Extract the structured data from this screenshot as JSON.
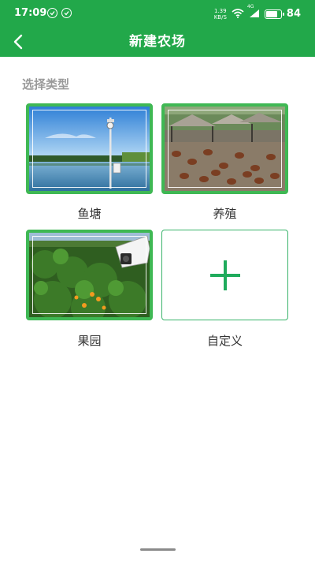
{
  "status_bar": {
    "time": "17:09",
    "net_speed_value": "1.39",
    "net_speed_unit": "KB/S",
    "signal_label": "4G",
    "battery_level": 84,
    "battery_text": "84"
  },
  "nav": {
    "title": "新建农场"
  },
  "section": {
    "label": "选择类型"
  },
  "types": [
    {
      "label": "鱼塘",
      "image": "fish-pond-photo"
    },
    {
      "label": "养殖",
      "image": "poultry-farm-photo"
    },
    {
      "label": "果园",
      "image": "orchard-photo"
    },
    {
      "label": "自定义",
      "image": "plus-icon"
    }
  ],
  "colors": {
    "header": "#22a84a",
    "card_border": "#3fb854",
    "plus": "#1fab5c"
  }
}
